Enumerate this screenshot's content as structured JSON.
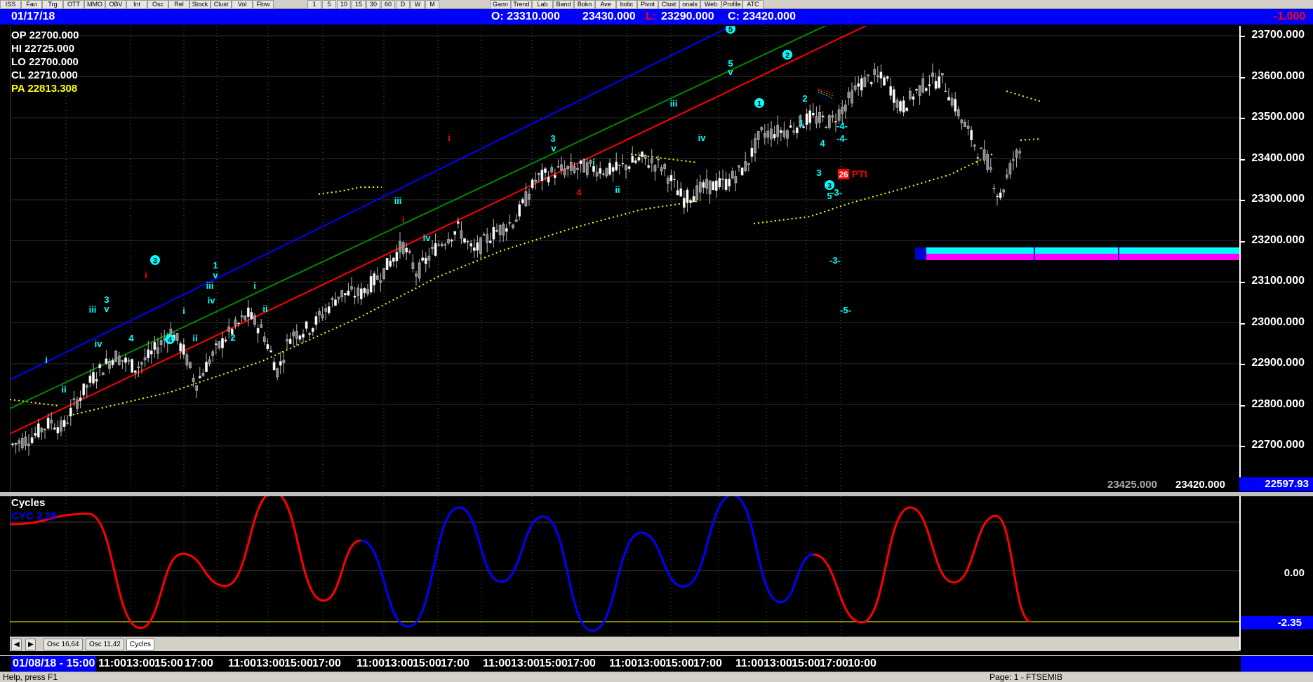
{
  "toolbar": {
    "left_buttons": [
      "ISS",
      "Fan",
      "Trg",
      "OTT",
      "MMO",
      "OBV",
      "Int",
      "Osc",
      "Rel",
      "Stock",
      "Clust",
      "Vol",
      "Flow"
    ],
    "period_buttons": [
      "1",
      "5",
      "10",
      "15",
      "30",
      "60",
      "D",
      "W",
      "M"
    ],
    "right_buttons": [
      "Gann",
      "Trend",
      "Lab",
      "Band",
      "Bokn",
      "Ave",
      "bolic",
      "Pivot",
      "Clust",
      "onals",
      "Web",
      "Profile",
      "ATC"
    ]
  },
  "infobar": {
    "date": "01/17/18",
    "open": "O: 23310.000",
    "high": "23430.000",
    "low_label": "L:",
    "low": "23290.000",
    "close": "C: 23420.000",
    "change": "-1.000"
  },
  "ohlc_panel": {
    "op": "OP  22700.000",
    "hi": "HI   22725.000",
    "lo": "LO  22700.000",
    "cl": "CL  22710.000",
    "pa": "PA  22813.308"
  },
  "price_axis": {
    "ticks": [
      "23700.000",
      "23600.000",
      "23500.000",
      "23400.000",
      "23300.000",
      "23200.000",
      "23100.000",
      "23000.000",
      "22900.000",
      "22800.000",
      "22700.000"
    ],
    "current_box": "22597.93"
  },
  "footer_prices": {
    "left": "23425.000",
    "right": "23420.000"
  },
  "wave_labels": {
    "red_i": "i",
    "red_4": "4",
    "pti_count": "26",
    "pti": "PTI",
    "green_labels": [
      "i",
      "ii",
      "iii",
      "iv",
      "v",
      "3",
      "4",
      "2",
      "1",
      "3",
      "v",
      "i",
      "ii",
      "iii",
      "iv",
      "v",
      "5",
      "3",
      "2",
      "1",
      "4",
      "5",
      "3",
      "-4-",
      "-4-",
      "-3-",
      "-3-",
      "-5-"
    ],
    "circled": [
      "3",
      "4",
      "5",
      "2",
      "1",
      "3"
    ]
  },
  "oscillator": {
    "title": "Cycles",
    "value_label": "CYC 2.28",
    "zero_tick": "0.00",
    "current_box": "-2.35",
    "colors": {
      "up": "#0000ff",
      "down": "#ff0000"
    }
  },
  "tabs": [
    "Osc 16,64",
    "Osc 11,42",
    "Cycles"
  ],
  "timeaxis": {
    "first": "01/08/18 - 15:00",
    "labels": [
      "11:00",
      "13:00",
      "15:00",
      "17:00",
      "11:00",
      "13:00",
      "15:00",
      "17:00",
      "11:00",
      "13:00",
      "15:00",
      "17:00",
      "11:00",
      "13:00",
      "15:00",
      "17:00",
      "11:00",
      "13:00",
      "15:00",
      "17:00",
      "11:00",
      "13:00",
      "15:00",
      "17:00",
      "10:00"
    ]
  },
  "status": {
    "help": "Help, press F1",
    "page": "Page: 1 - FTSEMIB"
  },
  "colors": {
    "channel_blue": "#0000ff",
    "channel_green": "#008800",
    "channel_red": "#ff0000",
    "dotted": "#ffff00",
    "wave_labels": "#00ffff",
    "candle": "#ffffff",
    "zone_cyan": "#00ffff",
    "zone_magenta": "#ff00ff"
  }
}
